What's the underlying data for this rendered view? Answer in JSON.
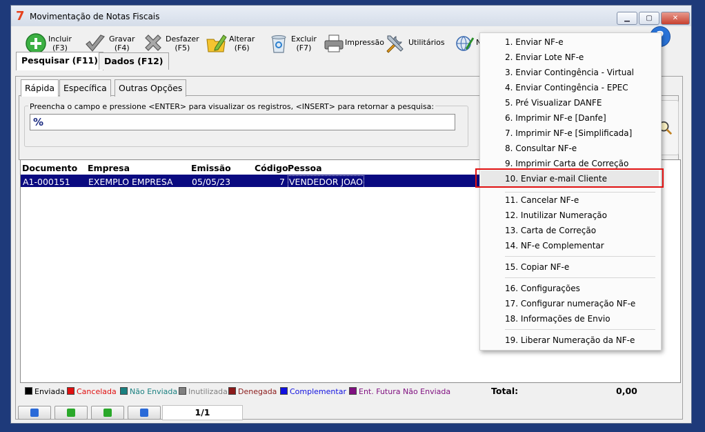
{
  "window": {
    "title": "Movimentação de Notas Fiscais",
    "logo": "7",
    "controls": [
      "minimize-icon",
      "maximize-icon",
      "close-icon"
    ]
  },
  "toolbar": {
    "incluir": {
      "label": "Incluir",
      "key": "(F3)"
    },
    "gravar": {
      "label": "Gravar",
      "key": "(F4)"
    },
    "desfazer": {
      "label": "Desfazer",
      "key": "(F5)"
    },
    "alterar": {
      "label": "Alterar",
      "key": "(F6)"
    },
    "excluir": {
      "label": "Excluir",
      "key": "(F7)"
    },
    "impressao": {
      "label": "Impressão"
    },
    "utilitarios": {
      "label": "Utilitários"
    },
    "nfe": {
      "label": "N"
    }
  },
  "tabs": {
    "pesquisar": "Pesquisar (F11)",
    "dados": "Dados (F12)"
  },
  "subtabs": {
    "rapida": "Rápida",
    "especifica": "Específica",
    "outras": "Outras Opções"
  },
  "search": {
    "label": "Preencha o campo e pressione <ENTER> para visualizar os registros, <INSERT> para retornar a pesquisa:",
    "value": "%"
  },
  "grid": {
    "columns": [
      "Documento",
      "Empresa",
      "Emissão",
      "Código",
      "Pessoa"
    ],
    "rows": [
      {
        "documento": "A1-000151",
        "empresa": "EXEMPLO EMPRESA",
        "emissao": "05/05/23",
        "codigo": "7",
        "pessoa": "VENDEDOR JOAO"
      }
    ]
  },
  "legend": [
    {
      "label": "Enviada",
      "color": "#000000"
    },
    {
      "label": "Cancelada",
      "color": "#e01010"
    },
    {
      "label": "Não Enviada",
      "color": "#1a8080"
    },
    {
      "label": "Inutilizada",
      "color": "#808080"
    },
    {
      "label": "Denegada",
      "color": "#8b1a1a"
    },
    {
      "label": "Complementar",
      "color": "#1010e0"
    },
    {
      "label": "Ent. Futura Não Enviada",
      "color": "#801080"
    }
  ],
  "total": {
    "label": "Total:",
    "value": "0,00"
  },
  "pager": {
    "counter": "1/1"
  },
  "menu": {
    "items": [
      "1. Enviar NF-e",
      "2. Enviar Lote NF-e",
      "3. Enviar Contingência - Virtual",
      "4. Enviar Contingência - EPEC",
      "5. Pré Visualizar DANFE",
      "6. Imprimir NF-e [Danfe]",
      "7. Imprimir NF-e [Simplificada]",
      "8. Consultar NF-e",
      "9. Imprimir Carta de Correção",
      "10. Enviar e-mail Cliente",
      "11. Cancelar NF-e",
      "12. Inutilizar Numeração",
      "13. Carta de Correção",
      "14. NF-e Complementar",
      "15. Copiar NF-e",
      "16. Configurações",
      "17. Configurar numeração NF-e",
      "18. Informações de Envio",
      "19. Liberar Numeração da NF-e"
    ],
    "highlighted_index": 9
  },
  "colors": {
    "selection": "#0a0a80",
    "highlight_border": "#e01010",
    "help": "#2a73d8"
  }
}
